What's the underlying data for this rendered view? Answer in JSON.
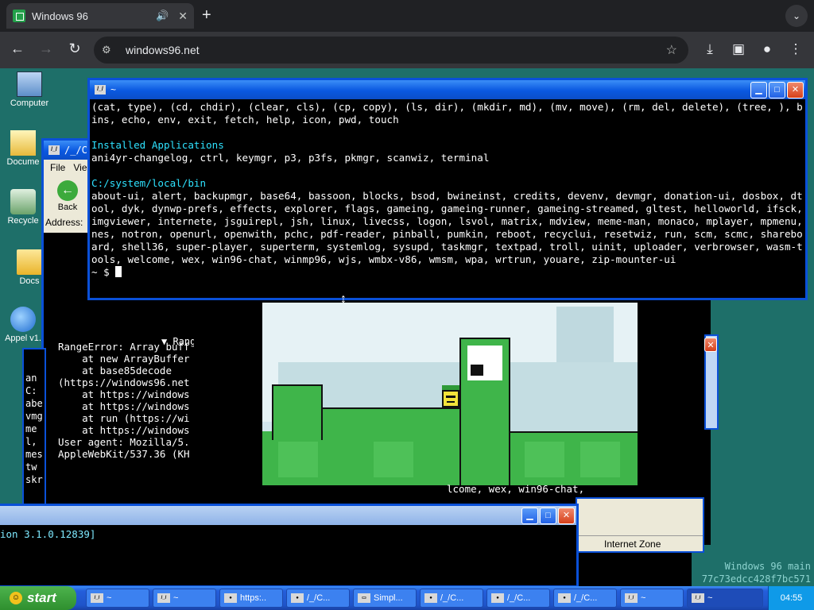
{
  "browser": {
    "tab_title": "Windows 96",
    "url": "windows96.net"
  },
  "desktop": {
    "icons": [
      {
        "label": "Computer"
      },
      {
        "label": "Docume"
      },
      {
        "label": "Recycle"
      },
      {
        "label": "Docs"
      },
      {
        "label": "Appel v1."
      }
    ]
  },
  "explorer": {
    "menu_file": "File",
    "menu_view": "Vie",
    "back_label": "Back",
    "address_label": "Address:",
    "range_heading": "▼ Rang",
    "error_lines": [
      "RangeError: Array buff",
      "    at new ArrayBuffer",
      "    at base85decode",
      "(https://windows96.net",
      "    at https://windows",
      "    at https://windows",
      "    at run (https://wi",
      "    at https://windows",
      "User agent: Mozilla/5.",
      "AppleWebKit/537.36 (KH"
    ]
  },
  "left_terminal": {
    "lines": [
      "an",
      "C:",
      "abe",
      "vmg",
      "me",
      "l,",
      "mes",
      "tw",
      "skr"
    ]
  },
  "main_terminal": {
    "title": "~",
    "line1": "(cat, type), (cd, chdir), (clear, cls), (cp, copy), (ls, dir), (mkdir, md), (mv, move), (rm, del, delete), (tree, ), bins, echo, env, exit, fetch, help, icon, pwd, touch",
    "heading_installed": "Installed Applications",
    "installed": "ani4yr-changelog, ctrl, keymgr, p3, p3fs, pkmgr, scanwiz, terminal",
    "heading_bin": "C:/system/local/bin",
    "bin": "about-ui, alert, backupmgr, base64, bassoon, blocks, bsod, bwineinst, credits, devenv, devmgr, donation-ui, dosbox, dtool, dyk, dynwp-prefs, effects, explorer, flags, gameing, gameing-runner, gameing-streamed, gltest, helloworld, ifsck, imgviewer, internete, jsguirepl, jsh, linux, livecss, logon, lsvol, matrix, mdview, meme-man, monaco, mplayer, mpmenu, nes, notron, openurl, openwith, pchc, pdf-reader, pinball, pumkin, reboot, recyclui, resetwiz, run, scm, scmc, shareboard, shell36, super-player, superterm, systemlog, sysupd, taskmgr, textpad, troll, uinit, uploader, verbrowser, wasm-tools, welcome, wex, win96-chat, winmp96, wjs, wmbx-v86, wmsm, wpa, wrtrun, youare, zip-mounter-ui",
    "prompt": "~ $ "
  },
  "game_window": {
    "terminal_tail": "lcome, wex, win96-chat,"
  },
  "right_window": {
    "status": "Internet Zone"
  },
  "right_bottom": {
    "line1": "Windows 96 main",
    "line2": "77c73edcc428f7bc571"
  },
  "bottom_terminal": {
    "text": "ion 3.1.0.12839]"
  },
  "taskbar": {
    "start_label": "start",
    "tasks": [
      "~",
      "~",
      "https:..",
      "/_/C...",
      "Simpl...",
      "/_/C...",
      "/_/C...",
      "/_/C...",
      "~",
      "~"
    ],
    "clock": "04:55"
  },
  "colors": {
    "desktop": "#1e6f69",
    "xp_blue": "#0a50d8",
    "terminal_cyan": "#2ee2ff",
    "game_green": "#3fb54a"
  }
}
